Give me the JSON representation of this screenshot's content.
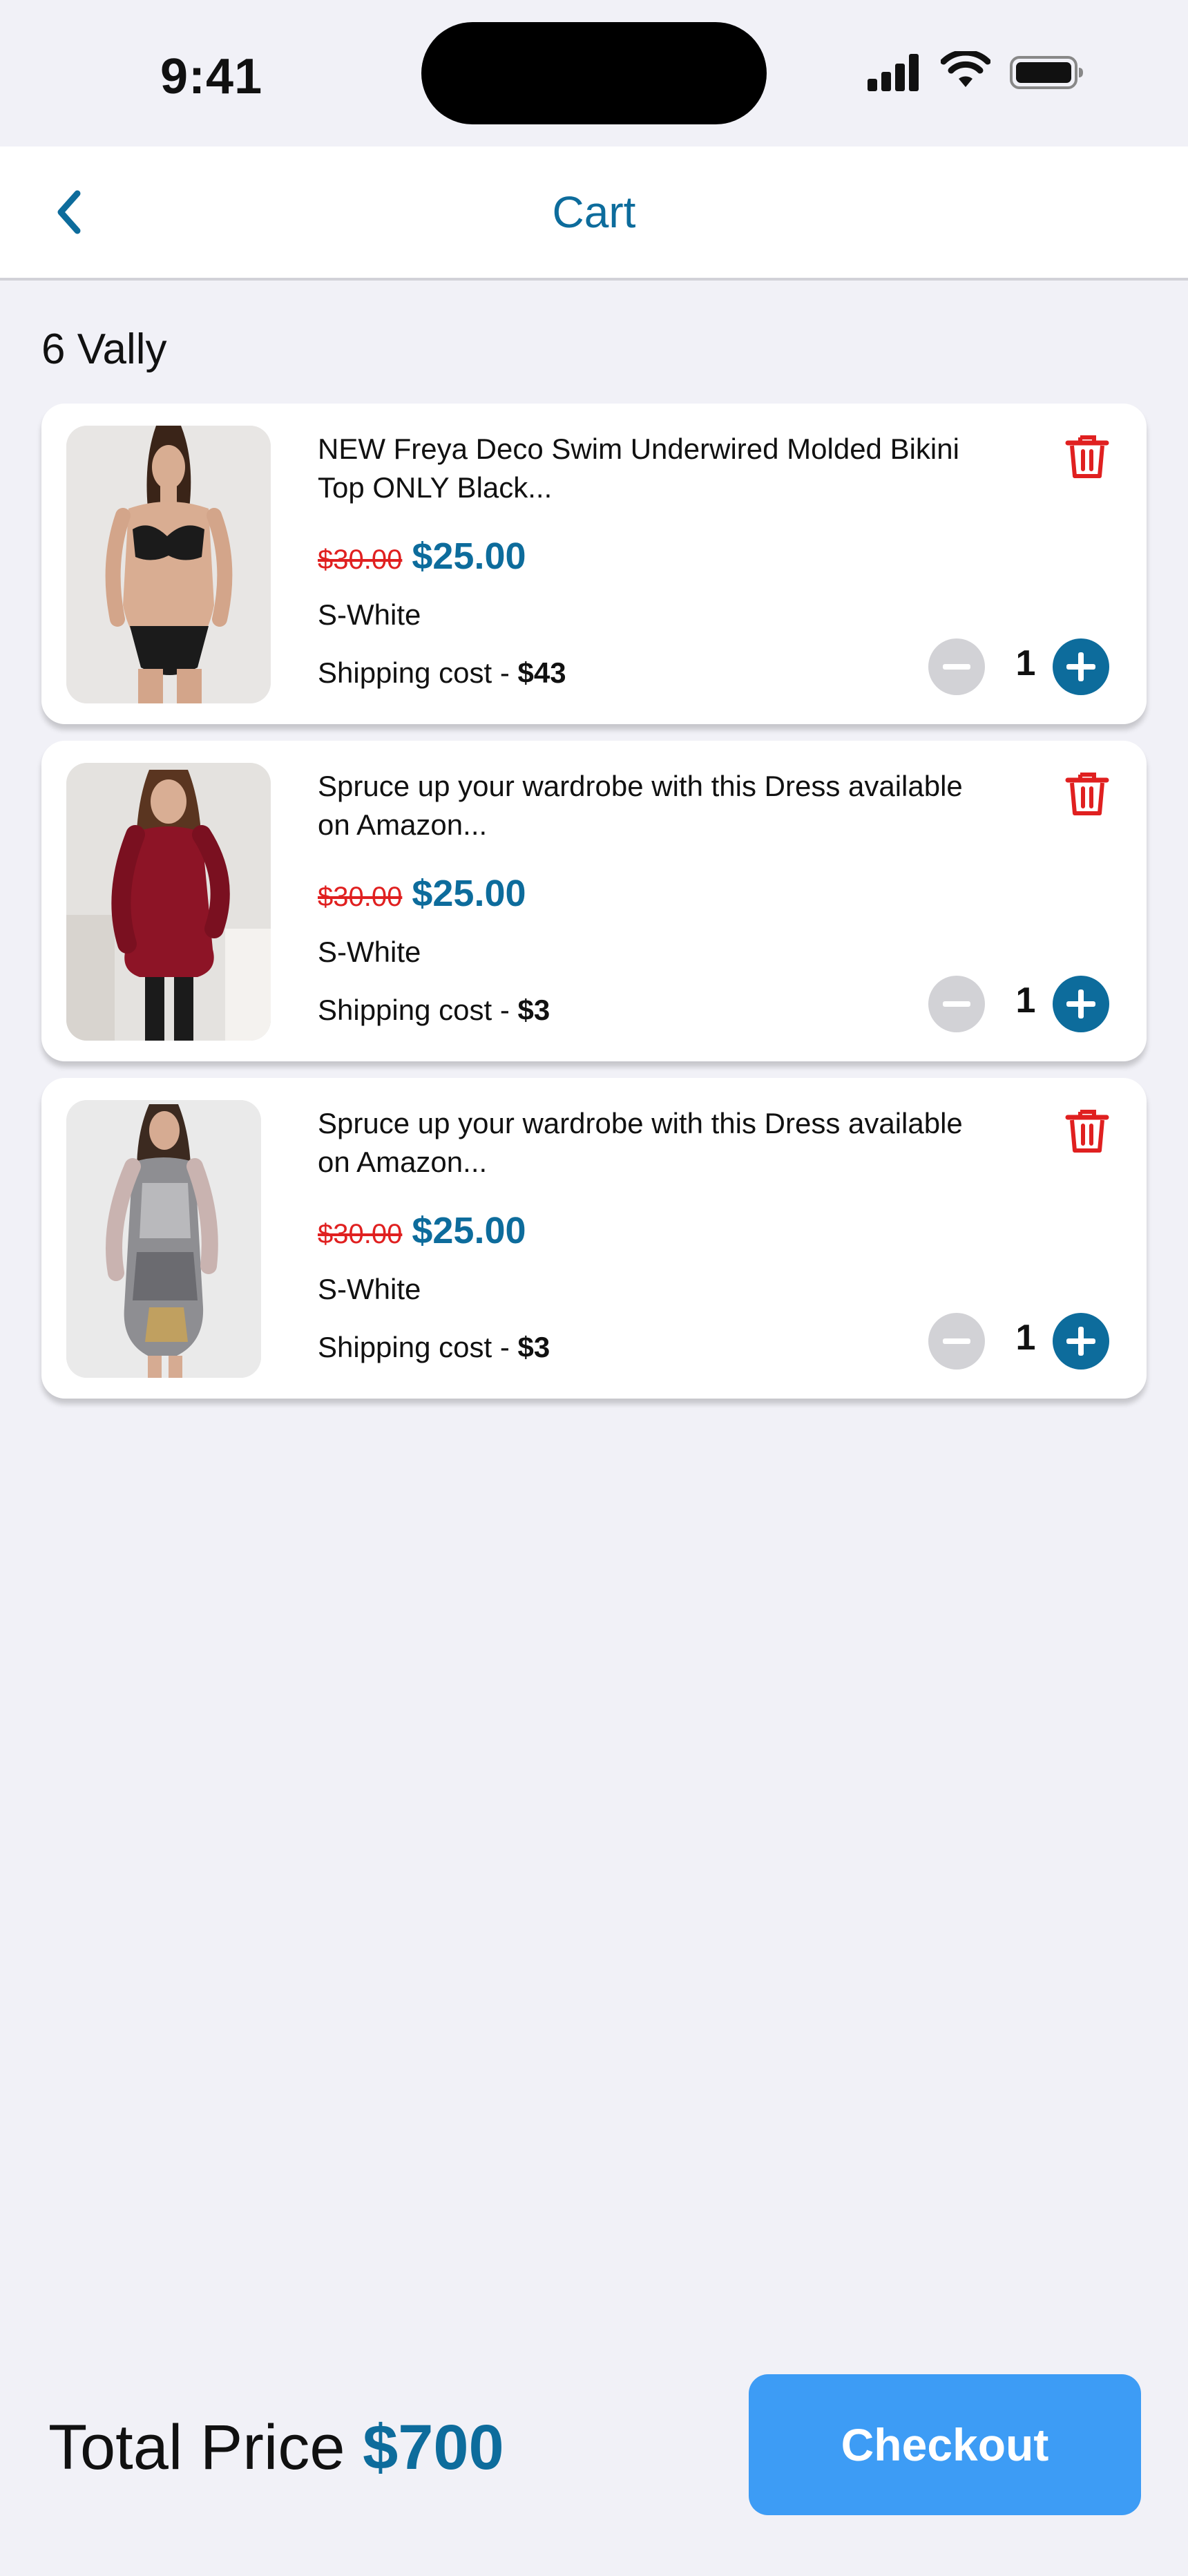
{
  "status_bar": {
    "time": "9:41"
  },
  "header": {
    "title": "Cart"
  },
  "store": {
    "name": "6 Vally"
  },
  "colors": {
    "accent": "#0d6c9c",
    "sale": "#e02020",
    "checkout": "#3d9cf5",
    "background": "#f1f1f7"
  },
  "items": [
    {
      "title": "NEW Freya Deco Swim Underwired Molded Bikini Top ONLY Black...",
      "old_price": "$30.00",
      "new_price": "$25.00",
      "variant": "S-White",
      "shipping_label": "Shipping cost - ",
      "shipping_value": "$43",
      "quantity": "1",
      "image": "bikini-product-photo"
    },
    {
      "title": "Spruce up your wardrobe with this Dress available on Amazon...",
      "old_price": "$30.00",
      "new_price": "$25.00",
      "variant": "S-White",
      "shipping_label": "Shipping cost - ",
      "shipping_value": "$3",
      "quantity": "1",
      "image": "red-dress-product-photo"
    },
    {
      "title": "Spruce up your wardrobe with this Dress available on Amazon...",
      "old_price": "$30.00",
      "new_price": "$25.00",
      "variant": "S-White",
      "shipping_label": "Shipping cost - ",
      "shipping_value": "$3",
      "quantity": "1",
      "image": "print-dress-product-photo"
    }
  ],
  "footer": {
    "total_label": "Total Price",
    "total_value": "$700",
    "checkout_label": "Checkout"
  }
}
